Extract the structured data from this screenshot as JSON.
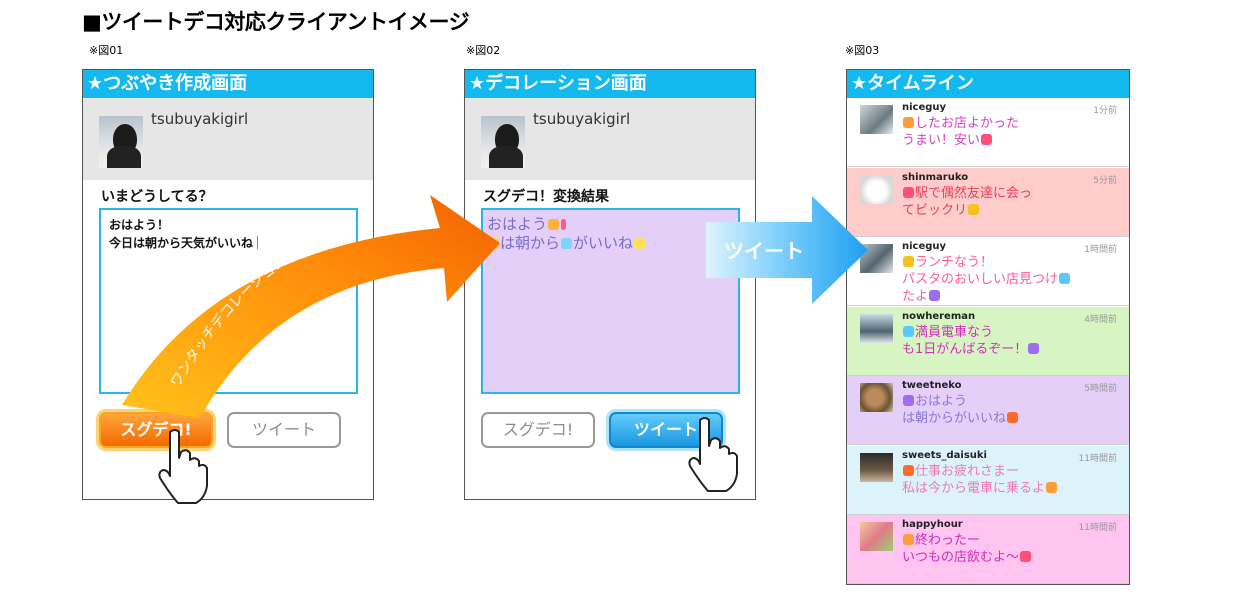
{
  "title": "■ツイートデコ対応クライアントイメージ",
  "fig1": {
    "label": "※図01",
    "header": "★つぶやき作成画面",
    "username": "tsubuyakigirl",
    "prompt": "いまどうしてる？",
    "text_line1": "おはよう！",
    "text_line2": "今日は朝から天気がいいね",
    "btn_deco": "スグデコ!",
    "btn_tweet": "ツイート"
  },
  "fig2": {
    "label": "※図02",
    "header": "★デコレーション画面",
    "username": "tsubuyakigirl",
    "prompt": "スグデコ！変換結果",
    "text_line1": "おはよう",
    "text_line2a": "は朝から",
    "text_line2b": "がいいね",
    "btn_deco": "スグデコ!",
    "btn_tweet": "ツイート"
  },
  "fig3": {
    "label": "※図03",
    "header": "★タイムライン"
  },
  "curve_label": "ワンタッチデコレーション",
  "arrow_label": "ツイート",
  "timeline": [
    {
      "name": "niceguy",
      "time": "1分前",
      "bg": "#ffffff",
      "color": "#d640c8",
      "line1": "したお店よかった",
      "line2": "うまい！安い"
    },
    {
      "name": "shinmaruko",
      "time": "5分前",
      "bg": "#ffcccc",
      "color": "#e8405a",
      "line1": "駅で偶然友達に会っ",
      "line2": "てビックリ"
    },
    {
      "name": "niceguy",
      "time": "1時間前",
      "bg": "#ffffff",
      "color": "#ff5a9c",
      "line1": "ランチなう！",
      "line2": "パスタのおいしい店見つけ",
      "line3": "たよ"
    },
    {
      "name": "nowhereman",
      "time": "4時間前",
      "bg": "#d6f5c2",
      "color": "#d430c0",
      "line1": "満員電車なう",
      "line2": "も1日がんばるぞー！"
    },
    {
      "name": "tweetneko",
      "time": "5時間前",
      "bg": "#e3cff8",
      "color": "#8a78d6",
      "line1": "おはよう",
      "line2": "は朝からがいいね"
    },
    {
      "name": "sweets_daisuki",
      "time": "11時間前",
      "bg": "#ddf3fb",
      "color": "#f07ab8",
      "line1": "仕事お疲れさまー",
      "line2": "私は今から電車に乗るよ"
    },
    {
      "name": "happyhour",
      "time": "11時間前",
      "bg": "#ffc4f0",
      "color": "#d02fb8",
      "line1": "終わったー",
      "line2": "いつもの店飲むよ〜"
    }
  ],
  "colors": {
    "header": "#13b9ef",
    "orange": "#f46a00",
    "blue": "#1a97e0"
  }
}
